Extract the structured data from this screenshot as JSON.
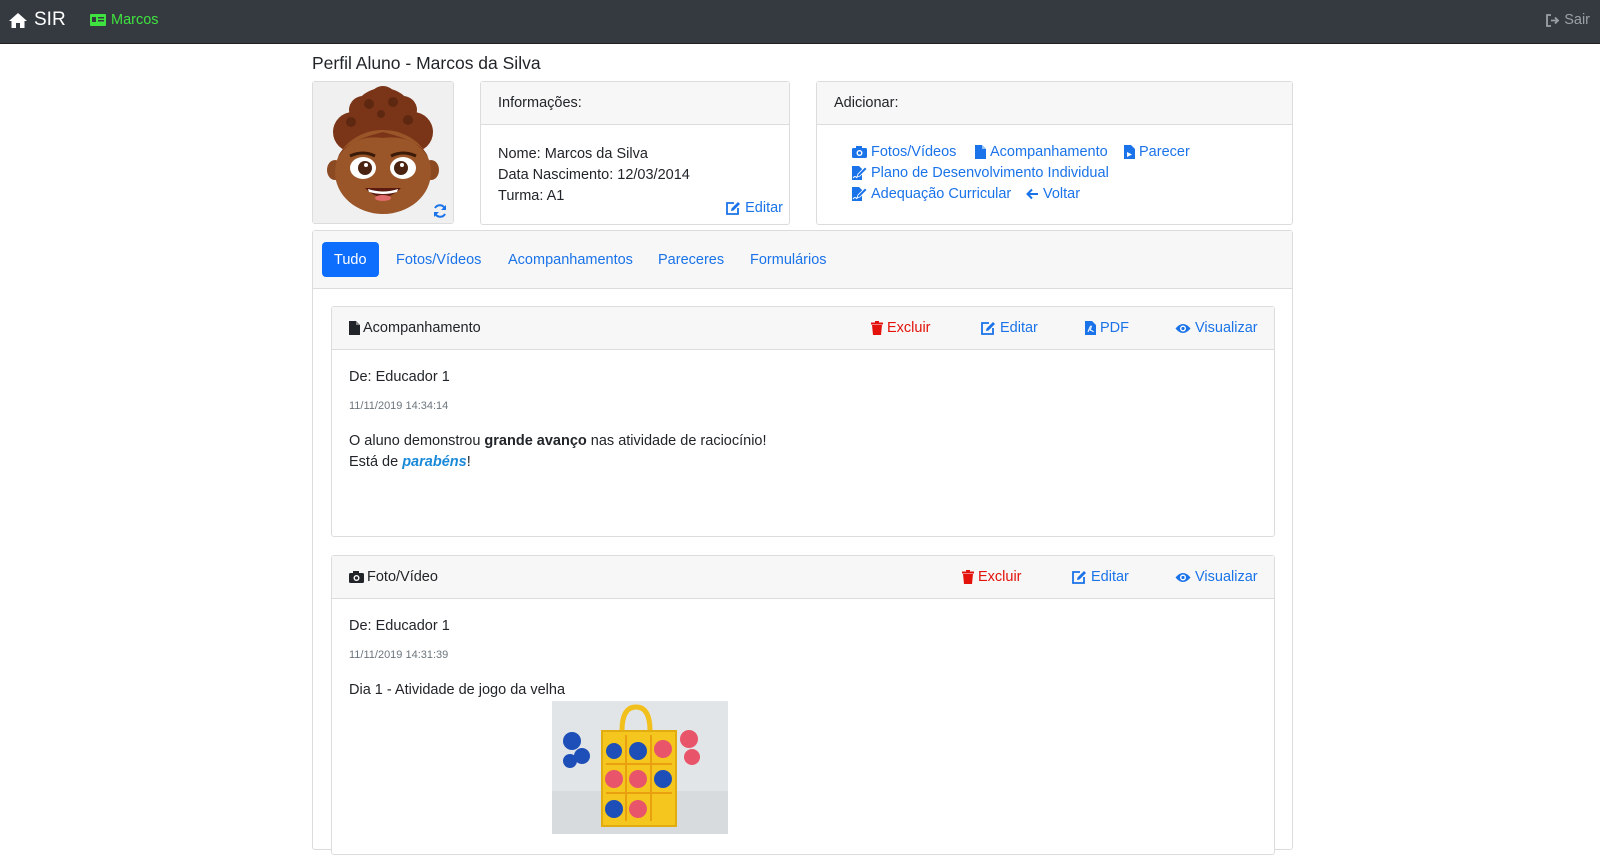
{
  "navbar": {
    "brand": "SIR",
    "user": "Marcos",
    "exit": "Sair"
  },
  "page": {
    "title": "Perfil Aluno - Marcos da Silva"
  },
  "info": {
    "header": "Informações:",
    "name": "Nome: Marcos da Silva",
    "birth": "Data Nascimento: 12/03/2014",
    "class": "Turma: A1",
    "edit": "Editar"
  },
  "add": {
    "header": "Adicionar:",
    "photos": "Fotos/Vídeos",
    "followup": "Acompanhamento",
    "opinion": "Parecer",
    "pdi": "Plano de Desenvolvimento Individual",
    "curricular": "Adequação Curricular",
    "back": "Voltar"
  },
  "tabs": {
    "all": "Tudo",
    "photos": "Fotos/Vídeos",
    "followups": "Acompanhamentos",
    "opinions": "Pareceres",
    "forms": "Formulários"
  },
  "posts": [
    {
      "type": "Acompanhamento",
      "delete": "Excluir",
      "edit": "Editar",
      "pdf": "PDF",
      "view": "Visualizar",
      "from": "De: Educador 1",
      "timestamp": "11/11/2019 14:34:14",
      "line1_a": "O aluno demonstrou ",
      "line1_b": "grande avanço",
      "line1_c": " nas atividade de raciocínio!",
      "line2_a": "Está de ",
      "line2_b": "parabéns",
      "line2_c": "!"
    },
    {
      "type": "Foto/Vídeo",
      "delete": "Excluir",
      "edit": "Editar",
      "view": "Visualizar",
      "from": "De: Educador 1",
      "timestamp": "11/11/2019 14:31:39",
      "caption": "Dia 1 - Atividade de jogo da velha"
    }
  ]
}
